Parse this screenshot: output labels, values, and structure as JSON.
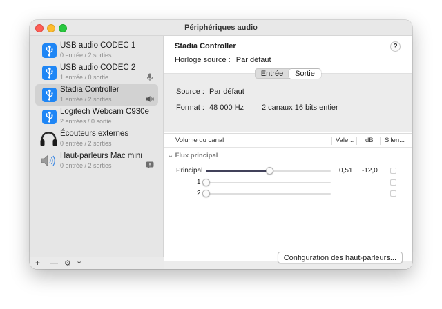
{
  "window": {
    "title": "Périphériques audio"
  },
  "sidebar": {
    "devices": [
      {
        "name": "USB audio CODEC 1",
        "sub": "0 entrée / 2 sorties",
        "icon": "usb-icon",
        "badge": ""
      },
      {
        "name": "USB audio CODEC 2",
        "sub": "1 entrée / 0 sortie",
        "icon": "usb-icon",
        "badge": "microphone-icon"
      },
      {
        "name": "Stadia Controller",
        "sub": "1 entrée / 2 sorties",
        "icon": "usb-icon",
        "badge": "speaker-icon",
        "selected": true
      },
      {
        "name": "Logitech Webcam C930e",
        "sub": "2 entrées / 0 sortie",
        "icon": "usb-icon",
        "badge": ""
      },
      {
        "name": "Écouteurs externes",
        "sub": "0 entrée / 2 sorties",
        "icon": "headphones-icon",
        "badge": ""
      },
      {
        "name": "Haut-parleurs Mac mini",
        "sub": "0 entrée / 2 sorties",
        "icon": "speaker-icon",
        "badge": "alert-icon"
      }
    ],
    "bottom": {
      "add": "+",
      "remove": "—",
      "gear": "⚙",
      "chevron": "⌄"
    }
  },
  "main": {
    "device_title": "Stadia Controller",
    "help": "?",
    "clock_label": "Horloge source :",
    "clock_value": "Par défaut",
    "tabs": [
      "Entrée",
      "Sortie"
    ],
    "selected_tab": "Sortie",
    "source_label": "Source :",
    "source_value": "Par défaut",
    "format_label": "Format :",
    "format_value": "48 000 Hz",
    "format_channels": "2 canaux 16 bits entier",
    "table": {
      "headers": [
        "Volume du canal",
        "Vale...",
        "dB",
        "Silen..."
      ],
      "group": "Flux principal",
      "rows": [
        {
          "label": "Principal",
          "value": "0,51",
          "db": "-12,0",
          "level": 0.51
        },
        {
          "label": "1",
          "value": "",
          "db": "",
          "level": 0
        },
        {
          "label": "2",
          "value": "",
          "db": "",
          "level": 0
        }
      ]
    },
    "configure_button": "Configuration des haut-parleurs..."
  },
  "colors": {
    "accent": "#1f86f5",
    "selected_row": "#d2d2d2",
    "slider_fill": "#41415a"
  }
}
